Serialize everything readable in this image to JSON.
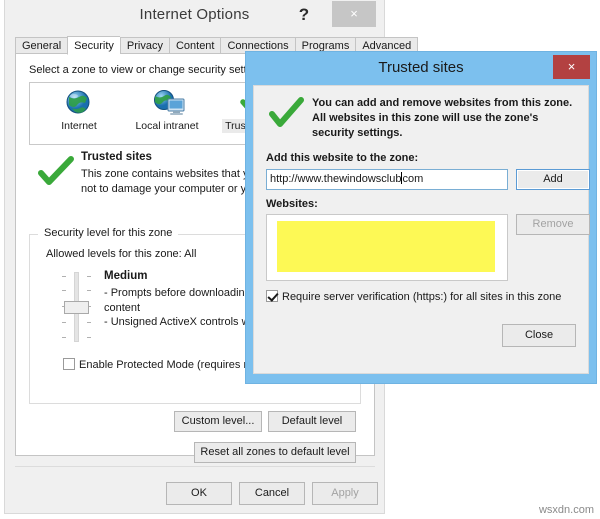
{
  "colors": {
    "dialog_titlebar": "#7cc0ee",
    "close_red": "#b34141",
    "redaction_yellow": "#fdf955",
    "check_green": "#3aa93a",
    "accent_focus": "#5b9bd5"
  },
  "internet_options": {
    "title": "Internet Options",
    "help_glyph": "?",
    "close_glyph": "×",
    "tabs": [
      {
        "label": "General",
        "active": false
      },
      {
        "label": "Security",
        "active": true
      },
      {
        "label": "Privacy",
        "active": false
      },
      {
        "label": "Content",
        "active": false
      },
      {
        "label": "Connections",
        "active": false
      },
      {
        "label": "Programs",
        "active": false
      },
      {
        "label": "Advanced",
        "active": false
      }
    ],
    "zone_prompt": "Select a zone to view or change security setting",
    "zones": [
      {
        "label": "Internet",
        "icon": "globe-icon",
        "selected": false
      },
      {
        "label": "Local intranet",
        "icon": "globe-monitor-icon",
        "selected": false
      },
      {
        "label": "Trusted sites",
        "icon": "green-check-icon",
        "selected": true
      }
    ],
    "zone_description": {
      "title": "Trusted sites",
      "body": "This zone contains websites that you trust not to damage your computer or your files."
    },
    "security_level": {
      "legend": "Security level for this zone",
      "allowed": "Allowed levels for this zone: All",
      "level_name": "Medium",
      "bullets": "- Prompts before downloading p\ncontent\n- Unsigned ActiveX controls will"
    },
    "protected_mode": {
      "label": "Enable Protected Mode (requires restar",
      "checked": false
    },
    "buttons": {
      "custom_level": "Custom level...",
      "default_level": "Default level",
      "reset_all": "Reset all zones to default level",
      "ok": "OK",
      "cancel": "Cancel",
      "apply": "Apply"
    }
  },
  "trusted_sites_dialog": {
    "title": "Trusted sites",
    "close_glyph": "×",
    "banner": "You can add and remove websites from this zone. All websites in this zone will use the zone's security settings.",
    "add_label": "Add this website to the zone:",
    "url_before_caret": "http://www.thewindowsclub",
    "url_after_caret": "com",
    "url_value": "http://www.thewindowsclub.com",
    "add_button": "Add",
    "websites_label": "Websites:",
    "remove_button": "Remove",
    "remove_disabled": true,
    "require_verification": {
      "label": "Require server verification (https:) for all sites in this zone",
      "checked": true
    },
    "close_button": "Close"
  },
  "watermark": "wsxdn.com"
}
